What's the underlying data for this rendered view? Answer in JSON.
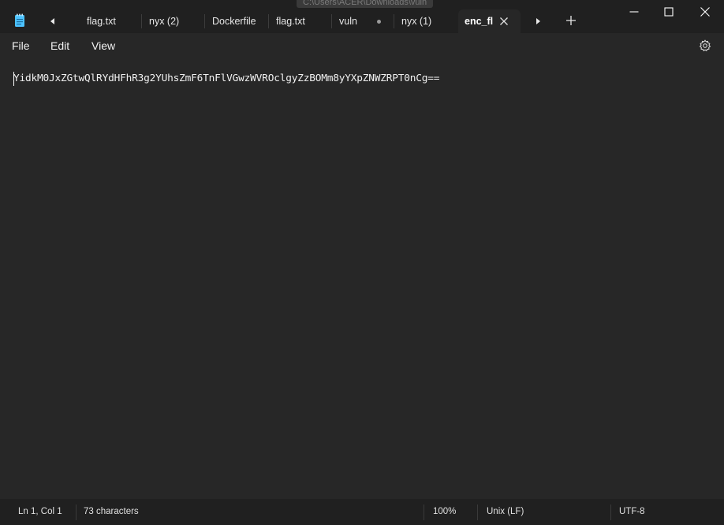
{
  "window": {
    "path_tooltip": "C:\\Users\\ACER\\Downloads\\vuln"
  },
  "tabs": [
    {
      "label": "flag.txt",
      "modified": false,
      "active": false
    },
    {
      "label": "nyx (2)",
      "modified": false,
      "active": false
    },
    {
      "label": "Dockerfile",
      "modified": false,
      "active": false
    },
    {
      "label": "flag.txt",
      "modified": false,
      "active": false
    },
    {
      "label": "vuln",
      "modified": true,
      "active": false
    },
    {
      "label": "nyx (1)",
      "modified": false,
      "active": false
    },
    {
      "label": "enc_fl",
      "modified": false,
      "active": true
    }
  ],
  "menu": {
    "file": "File",
    "edit": "Edit",
    "view": "View"
  },
  "editor": {
    "content": "YidkM0JxZGtwQlRYdHFhR3g2YUhsZmF6TnFlVGwzWVROclgyZzBOMm8yYXpZNWZRPT0nCg=="
  },
  "status": {
    "position": "Ln 1, Col 1",
    "characters": "73 characters",
    "zoom": "100%",
    "line_ending": "Unix (LF)",
    "encoding": "UTF-8"
  },
  "icons": {
    "app": "notepad-icon",
    "scroll_left": "caret-left-icon",
    "scroll_right": "caret-right-icon",
    "new_tab": "plus-icon",
    "close_tab": "close-icon",
    "settings": "gear-icon",
    "minimize": "minimize-icon",
    "maximize": "maximize-icon",
    "close_window": "close-icon"
  },
  "colors": {
    "titlebar": "#202020",
    "editor_bg": "#272727",
    "accent_icon": "#4cc2ff"
  }
}
